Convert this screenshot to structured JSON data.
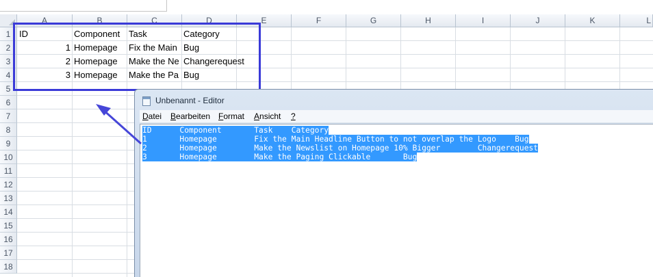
{
  "sheet": {
    "columns": [
      "A",
      "B",
      "C",
      "D",
      "E",
      "F",
      "G",
      "H",
      "I",
      "J",
      "K",
      "L"
    ],
    "rows": [
      "1",
      "2",
      "3",
      "4",
      "5",
      "6",
      "7",
      "8",
      "9",
      "10",
      "11",
      "12",
      "13",
      "14",
      "15",
      "16",
      "17",
      "18"
    ],
    "header": {
      "id": "ID",
      "component": "Component",
      "task": "Task",
      "category": "Category"
    },
    "data": [
      {
        "id": "1",
        "component": "Homepage",
        "task": "Fix the Main",
        "category": "Bug"
      },
      {
        "id": "2",
        "component": "Homepage",
        "task": "Make the Ne",
        "category": "Changerequest"
      },
      {
        "id": "3",
        "component": "Homepage",
        "task": "Make the Pa",
        "category": "Bug"
      }
    ]
  },
  "notepad": {
    "title": "Unbenannt - Editor",
    "menu": [
      {
        "accel": "D",
        "rest": "atei"
      },
      {
        "accel": "B",
        "rest": "earbeiten"
      },
      {
        "accel": "F",
        "rest": "ormat"
      },
      {
        "accel": "A",
        "rest": "nsicht"
      },
      {
        "accel": "?",
        "rest": ""
      }
    ],
    "lines": [
      "ID      Component       Task    Category",
      "1       Homepage        Fix the Main Headline Button to not overlap the Logo    Bug",
      "2       Homepage        Make the Newslist on Homepage 10% Bigger        Changerequest",
      "3       Homepage        Make the Paging Clickable       Bug"
    ]
  },
  "colors": {
    "selection_box": "#3a3ad8",
    "text_highlight": "#3399ff",
    "arrow": "#4646d8"
  },
  "icons": {
    "notepad_icon": "notepad-icon"
  }
}
